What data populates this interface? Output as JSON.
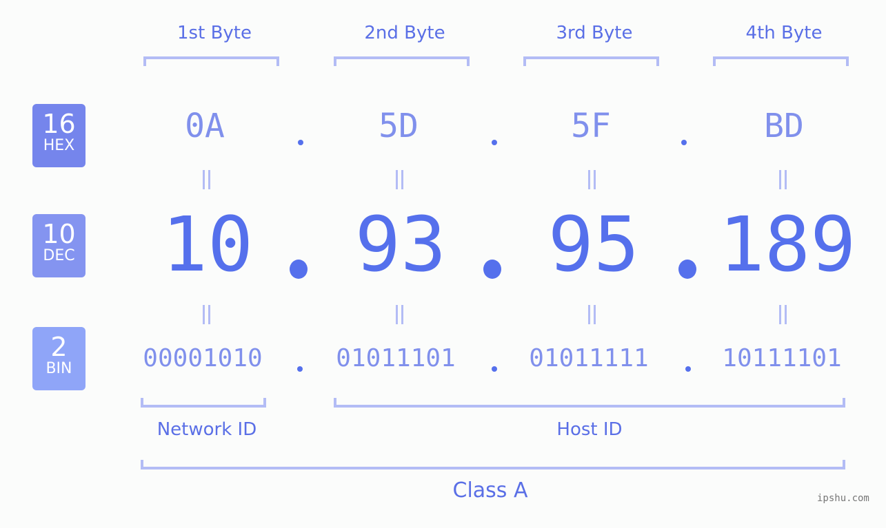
{
  "bytes": [
    {
      "header": "1st Byte",
      "hex": "0A",
      "dec": "10",
      "bin": "00001010"
    },
    {
      "header": "2nd Byte",
      "hex": "5D",
      "dec": "93",
      "bin": "01011101"
    },
    {
      "header": "3rd Byte",
      "hex": "5F",
      "dec": "95",
      "bin": "01011111"
    },
    {
      "header": "4th Byte",
      "hex": "BD",
      "dec": "189",
      "bin": "10111101"
    }
  ],
  "badges": {
    "hex": {
      "number": "16",
      "label": "HEX",
      "color": "#7585ec"
    },
    "dec": {
      "number": "10",
      "label": "DEC",
      "color": "#8494f0"
    },
    "bin": {
      "number": "2",
      "label": "BIN",
      "color": "#8fa5f8"
    }
  },
  "groups": {
    "network": "Network ID",
    "host": "Host ID",
    "class": "Class A"
  },
  "watermark": "ipshu.com",
  "colors": {
    "accent": "#5570ec",
    "light": "#8090ec",
    "bracket": "#b3bcf5"
  }
}
